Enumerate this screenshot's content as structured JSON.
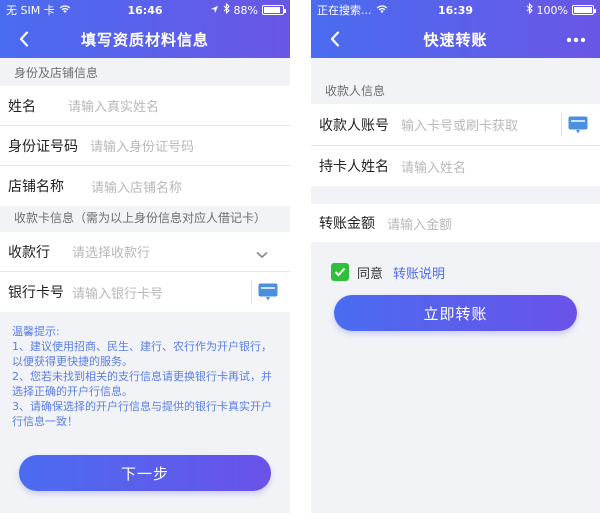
{
  "left": {
    "status": {
      "carrier": "无 SIM 卡",
      "time": "16:46",
      "battery": "88%",
      "battery_level": 0.88
    },
    "title": "填写资质材料信息",
    "section1": "身份及店铺信息",
    "fields1": [
      {
        "label": "姓名",
        "placeholder": "请输入真实姓名"
      },
      {
        "label": "身份证号码",
        "placeholder": "请输入身份证号码"
      },
      {
        "label": "店铺名称",
        "placeholder": "请输入店铺名称"
      }
    ],
    "section2": "收款卡信息（需为以上身份信息对应人借记卡）",
    "fields2": [
      {
        "label": "收款行",
        "placeholder": "请选择收款行"
      },
      {
        "label": "银行卡号",
        "placeholder": "请输入银行卡号"
      }
    ],
    "tip": {
      "title": "温馨提示:",
      "lines": [
        "1、建议使用招商、民生、建行、农行作为开户银行，以便获得更快捷的服务。",
        "2、您若未找到相关的支行信息请更换银行卡再试，并选择正确的开户行信息。",
        "3、请确保选择的开户行信息与提供的银行卡真实开户行信息一致！"
      ]
    },
    "next_button": "下一步"
  },
  "right": {
    "status": {
      "carrier": "正在搜索...",
      "time": "16:39",
      "battery": "100%",
      "battery_level": 1.0
    },
    "title": "快速转账",
    "section1": "收款人信息",
    "fields1": [
      {
        "label": "收款人账号",
        "placeholder": "输入卡号或刷卡获取"
      },
      {
        "label": "持卡人姓名",
        "placeholder": "请输入姓名"
      }
    ],
    "amount": {
      "label": "转账金额",
      "placeholder": "请输入金额"
    },
    "agree": {
      "text": "同意",
      "link": "转账说明"
    },
    "submit_button": "立即转账"
  },
  "colors": {
    "accent": "#4a6cf0",
    "accent2": "#6a56e6",
    "check": "#2fbf3a",
    "tip": "#5b7fe3"
  },
  "icons": [
    "back-arrow-icon",
    "wifi-icon",
    "battery-icon",
    "bluetooth-icon",
    "signal-icon",
    "chevron-down-icon",
    "card-reader-icon",
    "checkmark-icon",
    "more-icon"
  ]
}
